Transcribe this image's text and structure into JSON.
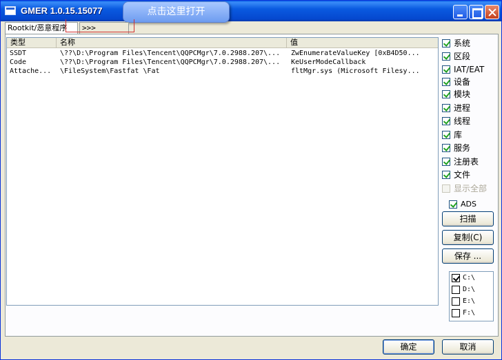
{
  "window": {
    "title": "GMER 1.0.15.15077"
  },
  "callout": {
    "text": "点击这里打开"
  },
  "tabs": [
    {
      "label": "Rootkit/恶意程序"
    },
    {
      "label": ">>>"
    }
  ],
  "table": {
    "columns": [
      "类型",
      "名称",
      "值"
    ],
    "rows": [
      {
        "type": "SSDT",
        "name": "\\??\\D:\\Program Files\\Tencent\\QQPCMgr\\7.0.2988.207\\...",
        "value": "ZwEnumerateValueKey [0xB4D50..."
      },
      {
        "type": "Code",
        "name": "\\??\\D:\\Program Files\\Tencent\\QQPCMgr\\7.0.2988.207\\...",
        "value": "KeUserModeCallback"
      },
      {
        "type": "Attache...",
        "name": "\\FileSystem\\Fastfat \\Fat",
        "value": "fltMgr.sys (Microsoft Filesy..."
      }
    ]
  },
  "options": [
    {
      "label": "系统",
      "checked": true
    },
    {
      "label": "区段",
      "checked": true
    },
    {
      "label": "IAT/EAT",
      "checked": true
    },
    {
      "label": "设备",
      "checked": true
    },
    {
      "label": "模块",
      "checked": true
    },
    {
      "label": "进程",
      "checked": true
    },
    {
      "label": "线程",
      "checked": true
    },
    {
      "label": "库",
      "checked": true
    },
    {
      "label": "服务",
      "checked": true
    },
    {
      "label": "注册表",
      "checked": true
    },
    {
      "label": "文件",
      "checked": true
    },
    {
      "label": "显示全部",
      "checked": false,
      "disabled": true
    }
  ],
  "ads": {
    "label": "ADS",
    "checked": true
  },
  "buttons": {
    "scan": "扫描",
    "copy": "复制(C)",
    "save": "保存 ..."
  },
  "drives": [
    {
      "label": "C:\\",
      "checked": true
    },
    {
      "label": "D:\\",
      "checked": false
    },
    {
      "label": "E:\\",
      "checked": false
    },
    {
      "label": "F:\\",
      "checked": false
    }
  ],
  "footer": {
    "ok": "确定",
    "cancel": "取消"
  },
  "colors": {
    "titlebar": "#0a5ae0",
    "callout": "#6e9cf0",
    "face": "#ece9d8",
    "check": "#21a121"
  }
}
